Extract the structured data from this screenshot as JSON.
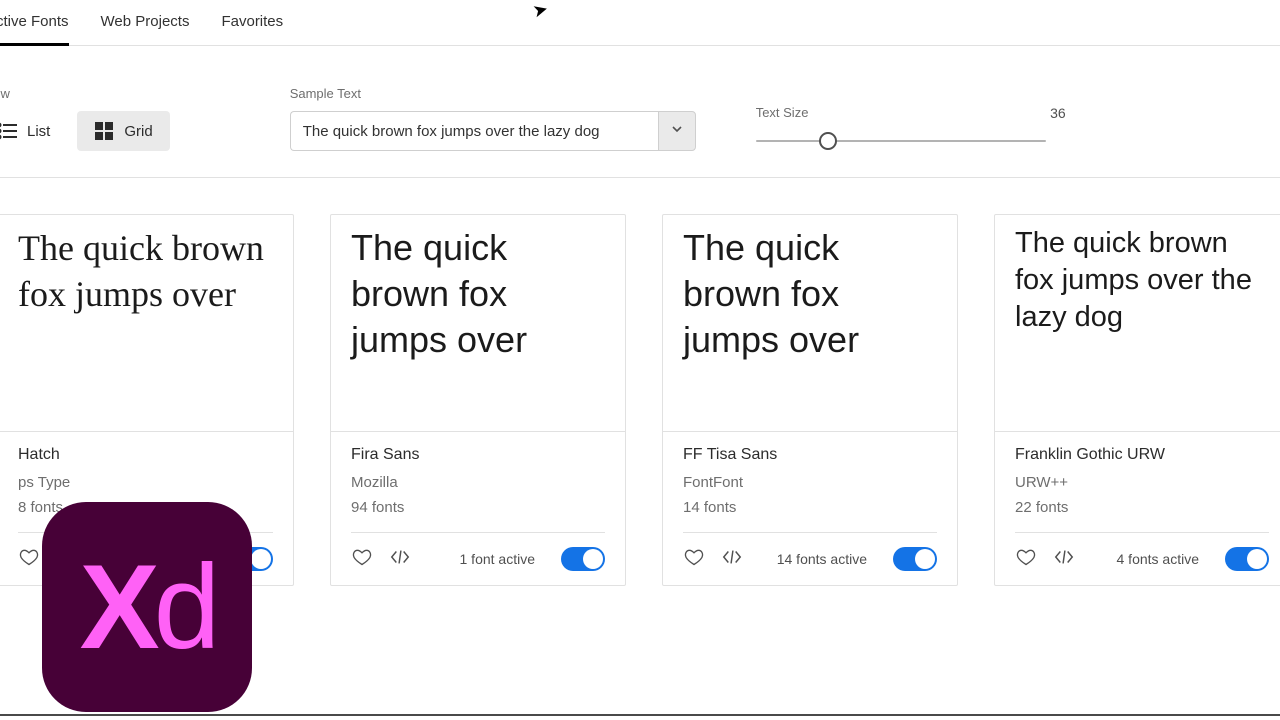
{
  "tabs": [
    {
      "label": "Active Fonts",
      "active": true
    },
    {
      "label": "Web Projects",
      "active": false
    },
    {
      "label": "Favorites",
      "active": false
    }
  ],
  "controls": {
    "view_label": "View",
    "list_label": "List",
    "grid_label": "Grid",
    "active_view": "grid",
    "sample_label": "Sample Text",
    "sample_value": "The quick brown fox jumps over the lazy dog",
    "text_size_label": "Text Size",
    "text_size_value": "36",
    "slider_percent": 22
  },
  "cards": [
    {
      "preview": "The quick brown fox jumps over",
      "name": "Hatch",
      "foundry": "ps Type",
      "count": "8 fonts",
      "active_text": "",
      "toggle_on": true
    },
    {
      "preview": "The quick brown fox jumps over",
      "name": "Fira Sans",
      "foundry": "Mozilla",
      "count": "94 fonts",
      "active_text": "1 font active",
      "toggle_on": true
    },
    {
      "preview": "The quick brown fox jumps over",
      "name": "FF Tisa Sans",
      "foundry": "FontFont",
      "count": "14 fonts",
      "active_text": "14 fonts active",
      "toggle_on": true
    },
    {
      "preview": "The quick brown fox jumps over the lazy dog",
      "name": "Franklin Gothic URW",
      "foundry": "URW++",
      "count": "22 fonts",
      "active_text": "4 fonts active",
      "toggle_on": true
    }
  ],
  "badge": {
    "text1": "X",
    "text2": "d"
  }
}
